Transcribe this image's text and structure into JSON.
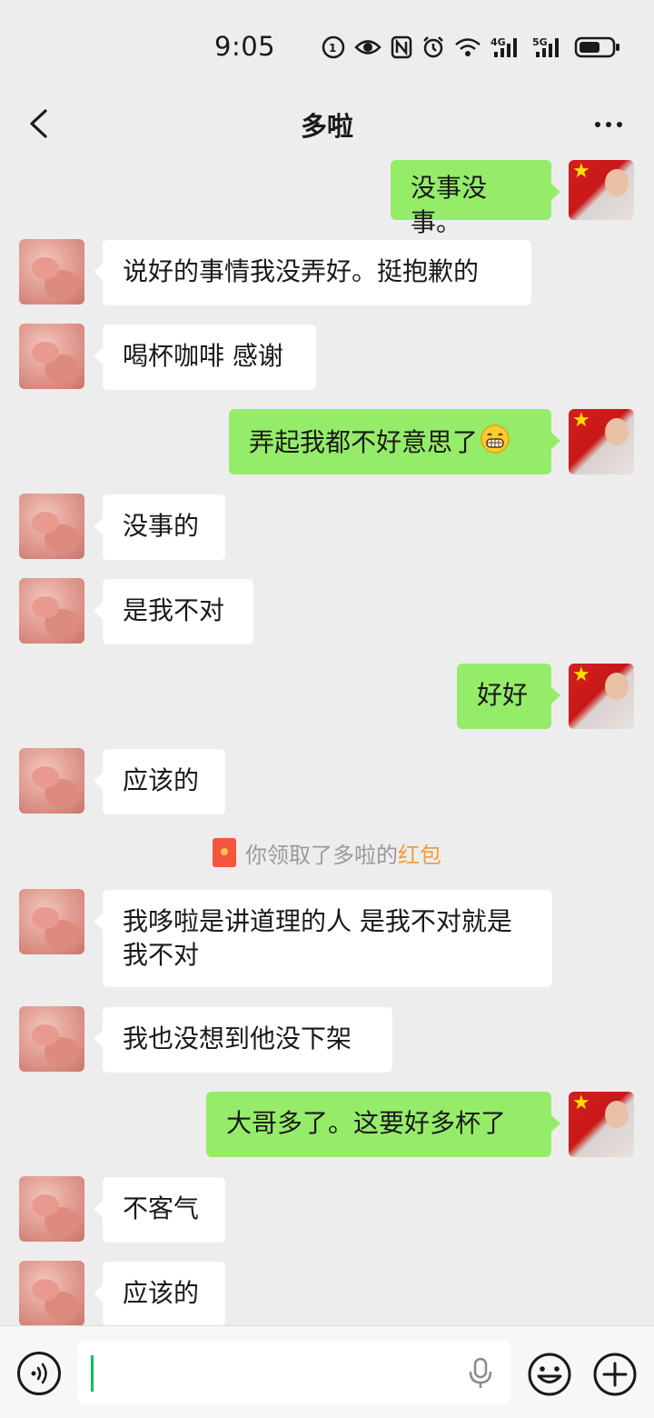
{
  "status_bar": {
    "time": "9:05",
    "icons": [
      "hd-call-icon",
      "eye-icon",
      "nfc-icon",
      "alarm-icon",
      "wifi-icon",
      "signal-4g-icon",
      "signal-5g-icon",
      "battery-icon"
    ],
    "net1": "4G",
    "net2": "5G"
  },
  "header": {
    "title": "多啦"
  },
  "messages": [
    {
      "side": "right",
      "text": "没事没事。"
    },
    {
      "side": "left",
      "text": "说好的事情我没弄好。挺抱歉的"
    },
    {
      "side": "left",
      "text": "喝杯咖啡 感谢"
    },
    {
      "side": "right",
      "text": "弄起我都不好意思了"
    },
    {
      "side": "left",
      "text": "没事的"
    },
    {
      "side": "left",
      "text": "是我不对"
    },
    {
      "side": "right",
      "text": "好好"
    },
    {
      "side": "left",
      "text": "应该的"
    },
    {
      "side": "left",
      "text": "我哆啦是讲道理的人 是我不对就是我不对"
    },
    {
      "side": "left",
      "text": "我也没想到他没下架"
    },
    {
      "side": "right",
      "text": "大哥多了。这要好多杯了"
    },
    {
      "side": "left",
      "text": "不客气"
    },
    {
      "side": "left",
      "text": "应该的"
    }
  ],
  "system_note": {
    "text": "你领取了多啦的",
    "link": "红包"
  },
  "colors": {
    "background": "#ededed",
    "bubble_self": "#95ec69",
    "bubble_other": "#ffffff",
    "link": "#f09c3a",
    "cursor": "#07c160"
  }
}
